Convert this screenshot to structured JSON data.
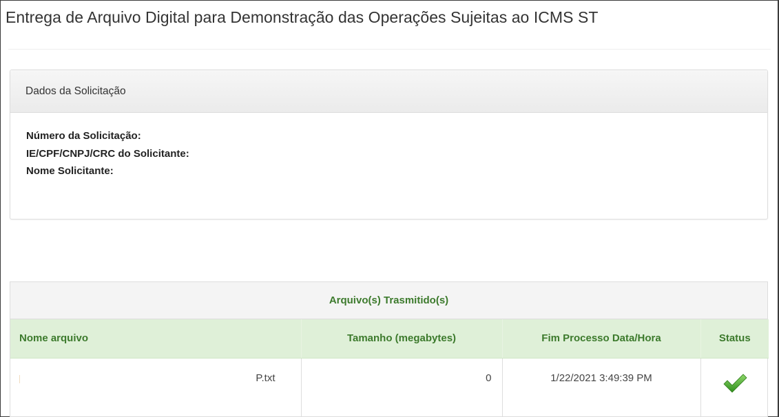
{
  "page": {
    "title": "Entrega de Arquivo Digital para Demonstração das Operações Sujeitas ao ICMS ST"
  },
  "request_panel": {
    "heading": "Dados da Solicitação",
    "fields": [
      {
        "label": "Número da Solicitação:"
      },
      {
        "label": "IE/CPF/CNPJ/CRC do Solicitante:"
      },
      {
        "label": "Nome Solicitante:"
      }
    ]
  },
  "files_table": {
    "caption": "Arquivo(s) Trasmitido(s)",
    "columns": {
      "name": "Nome arquivo",
      "size": "Tamanho (megabytes)",
      "end_time": "Fim Processo Data/Hora",
      "status": "Status"
    },
    "rows": [
      {
        "name": "P.txt",
        "size": "0",
        "end_time": "1/22/2021 3:49:39 PM",
        "status_icon": "checkmark-icon"
      }
    ]
  },
  "colors": {
    "header_green_bg": "#dff0d8",
    "header_green_text": "#3c7a2c",
    "check_green": "#4cae2a"
  }
}
